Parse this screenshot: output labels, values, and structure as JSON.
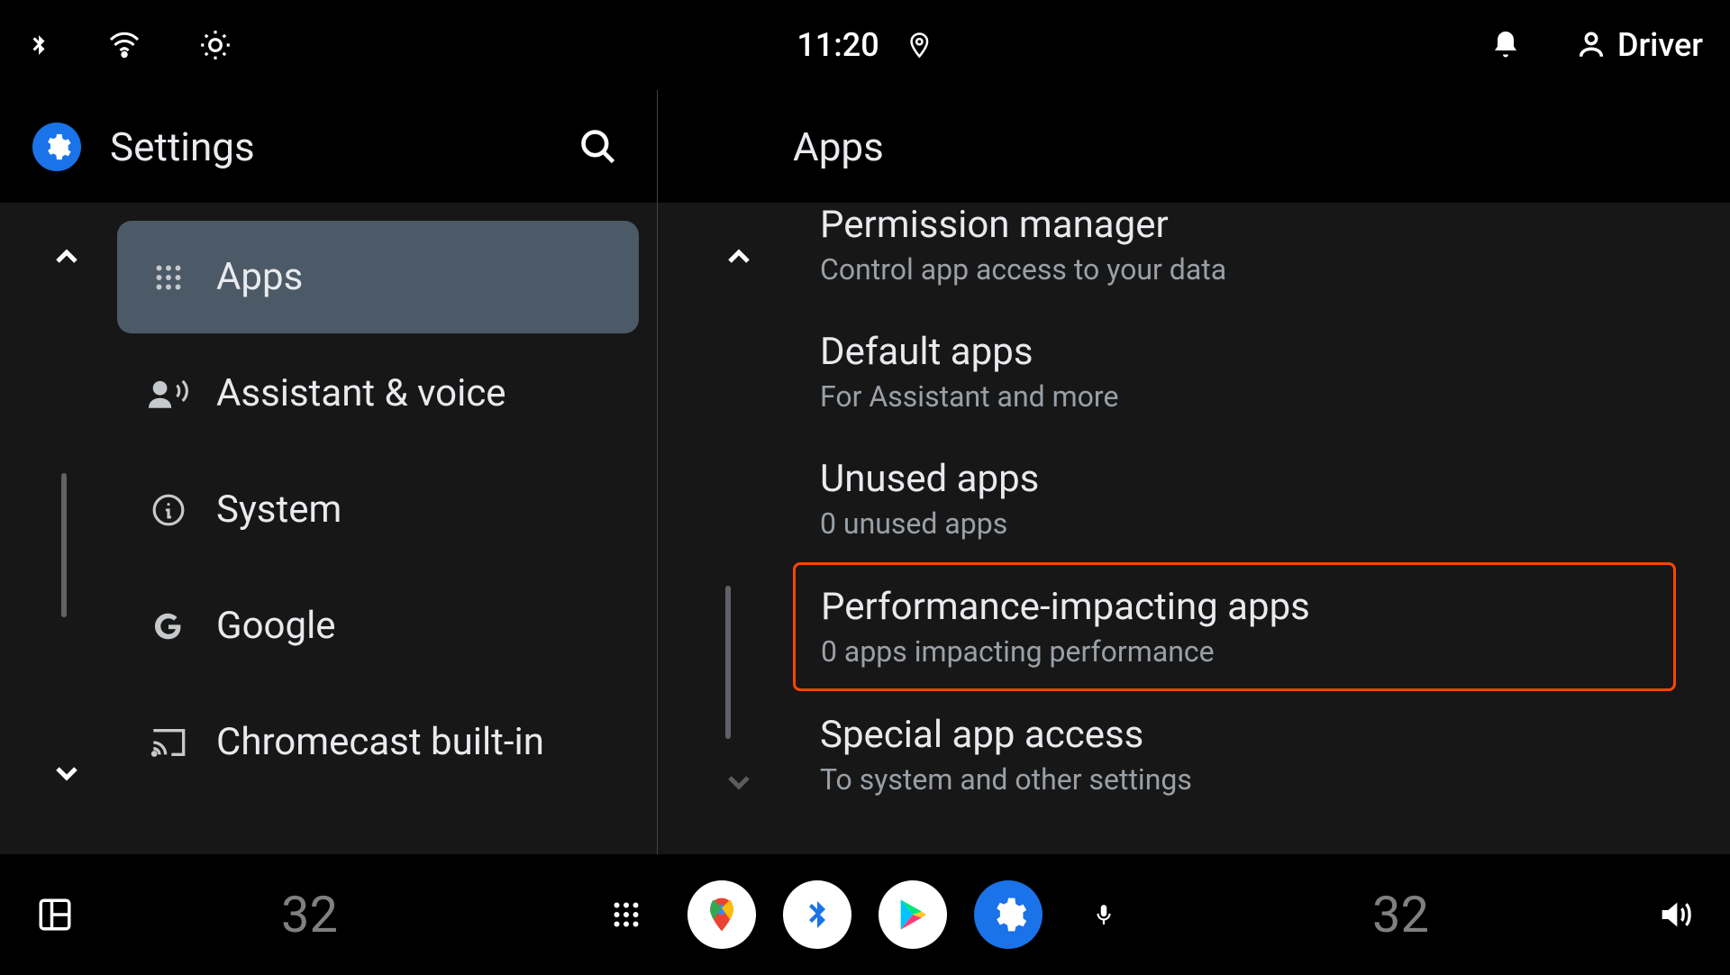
{
  "status": {
    "time": "11:20",
    "user": "Driver"
  },
  "left": {
    "title": "Settings",
    "items": [
      {
        "label": "Apps",
        "icon": "grid",
        "selected": true
      },
      {
        "label": "Assistant & voice",
        "icon": "assistant",
        "selected": false
      },
      {
        "label": "System",
        "icon": "info",
        "selected": false
      },
      {
        "label": "Google",
        "icon": "google",
        "selected": false
      },
      {
        "label": "Chromecast built-in",
        "icon": "cast",
        "selected": false
      }
    ]
  },
  "right": {
    "title": "Apps",
    "items": [
      {
        "title": "Permission manager",
        "sub": "Control app access to your data",
        "cut": true
      },
      {
        "title": "Default apps",
        "sub": "For Assistant and more"
      },
      {
        "title": "Unused apps",
        "sub": "0 unused apps"
      },
      {
        "title": "Performance-impacting apps",
        "sub": "0 apps impacting performance",
        "highlight": true
      },
      {
        "title": "Special app access",
        "sub": "To system and other settings"
      }
    ]
  },
  "bottom": {
    "temp_left": "32",
    "temp_right": "32"
  }
}
